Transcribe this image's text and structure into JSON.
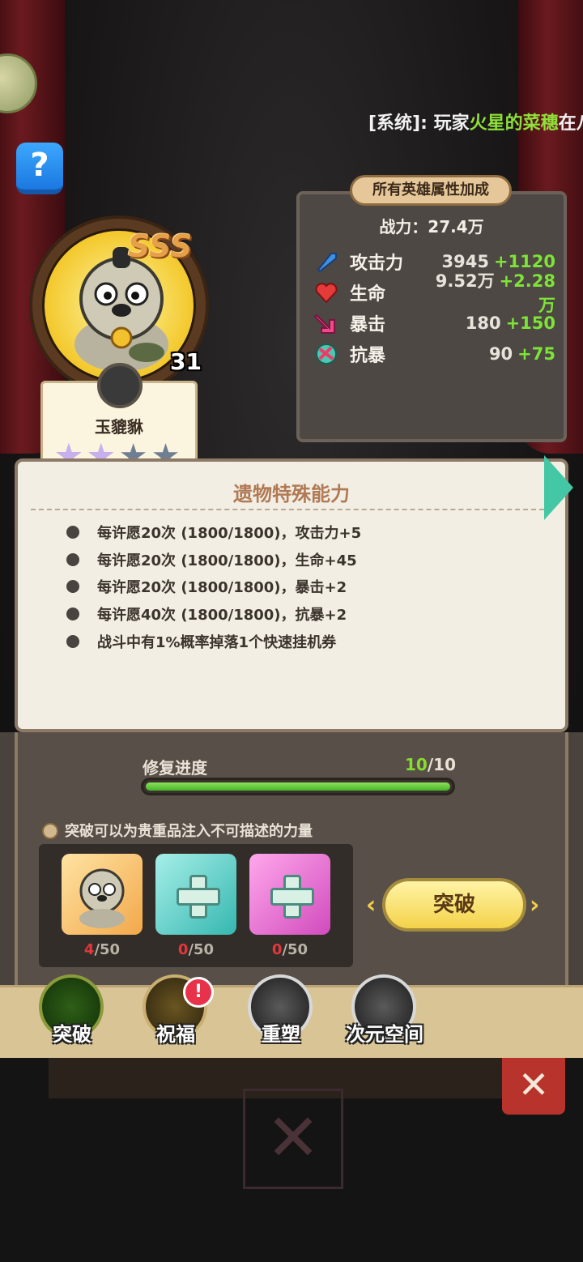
{
  "system_ticker": {
    "prefix": "[系统]: 玩家",
    "highlight": "火星的菜穗",
    "suffix": "在八"
  },
  "help_label": "?",
  "hero": {
    "rank": "SSS",
    "level": "31",
    "name": "玉貔貅",
    "stars_filled": 2,
    "stars_total": 4
  },
  "bonus_panel": {
    "title": "所有英雄属性加成",
    "power": "战力：27.4万",
    "stats": [
      {
        "icon": "sword-icon",
        "name": "攻击力",
        "value": "3945",
        "bonus": "+1120"
      },
      {
        "icon": "heart-icon",
        "name": "生命",
        "value": "9.52万",
        "bonus": "+2.28万"
      },
      {
        "icon": "crit-arrow-icon",
        "name": "暴击",
        "value": "180",
        "bonus": "+150"
      },
      {
        "icon": "anti-crit-icon",
        "name": "抗暴",
        "value": "90",
        "bonus": "+75"
      }
    ]
  },
  "relic": {
    "title": "遗物特殊能力",
    "abilities": [
      "每许愿20次 (1800/1800)，攻击力+5",
      "每许愿20次 (1800/1800)，生命+45",
      "每许愿20次 (1800/1800)，暴击+2",
      "每许愿40次 (1800/1800)，抗暴+2",
      "战斗中有1%概率掉落1个快速挂机券"
    ]
  },
  "repair": {
    "label": "修复进度",
    "current": "10",
    "total": "/10",
    "progress": 1.0
  },
  "hint": "突破可以为贵重品注入不可描述的力量",
  "materials": [
    {
      "name": "hero-shard",
      "current": "4",
      "total": "/50"
    },
    {
      "name": "teal-cross-shard",
      "current": "0",
      "total": "/50"
    },
    {
      "name": "pink-cross-shard",
      "current": "0",
      "total": "/50"
    }
  ],
  "break_button": "突破",
  "chevron_left": "‹",
  "chevron_right": "›",
  "tabs": [
    {
      "label": "突破"
    },
    {
      "label": "祝福",
      "badge": "!"
    },
    {
      "label": "重塑"
    },
    {
      "label": "次元空间"
    }
  ],
  "close_label": "✕",
  "colors": {
    "accent_green": "#7ee337",
    "bar_green": "#46b52a",
    "badge_red": "#e8314a",
    "close_red": "#b8332b"
  }
}
